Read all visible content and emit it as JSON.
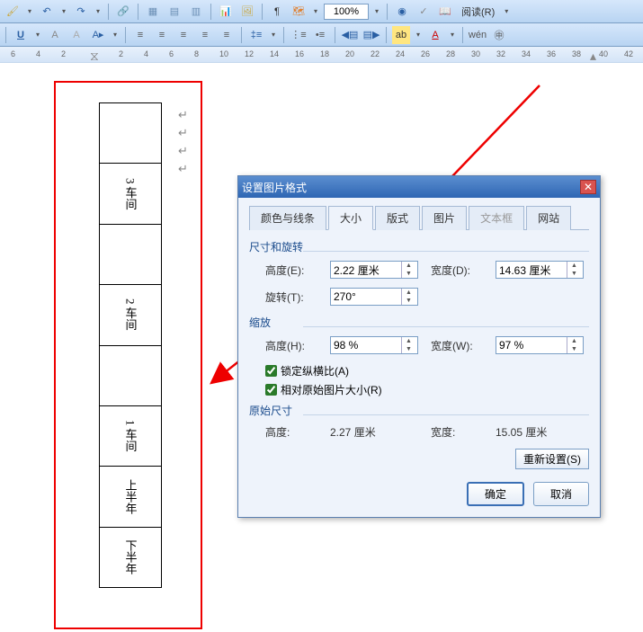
{
  "toolbar": {
    "zoom": "100%",
    "read_label": "阅读(R)"
  },
  "ruler_ticks": [
    "6",
    "4",
    "2",
    "",
    "2",
    "4",
    "6",
    "8",
    "10",
    "12",
    "14",
    "16",
    "18",
    "20",
    "22",
    "24",
    "26",
    "28",
    "30",
    "32",
    "34",
    "36",
    "38",
    "40",
    "42"
  ],
  "rotated_table": {
    "row1": [
      "",
      "3 车间"
    ],
    "row2": [
      "",
      "2 车间"
    ],
    "row3": [
      "",
      "1 车间"
    ],
    "row4": [
      "上半年",
      "下半年"
    ]
  },
  "paragraph_mark": "↵",
  "dialog": {
    "title": "设置图片格式",
    "tabs": {
      "colors": "颜色与线条",
      "size": "大小",
      "layout": "版式",
      "picture": "图片",
      "textbox": "文本框",
      "web": "网站"
    },
    "sections": {
      "size_rotate": "尺寸和旋转",
      "scale": "缩放",
      "original": "原始尺寸"
    },
    "labels": {
      "height_e": "高度(E):",
      "width_d": "宽度(D):",
      "rotate_t": "旋转(T):",
      "height_h": "高度(H):",
      "width_w": "宽度(W):",
      "height": "高度:",
      "width": "宽度:",
      "lock_aspect": "锁定纵横比(A)",
      "relative_orig": "相对原始图片大小(R)"
    },
    "values": {
      "height_e": "2.22 厘米",
      "width_d": "14.63 厘米",
      "rotate_t": "270°",
      "height_h": "98 %",
      "width_w": "97 %",
      "orig_height": "2.27 厘米",
      "orig_width": "15.05 厘米"
    },
    "buttons": {
      "reset": "重新设置(S)",
      "ok": "确定",
      "cancel": "取消"
    }
  }
}
